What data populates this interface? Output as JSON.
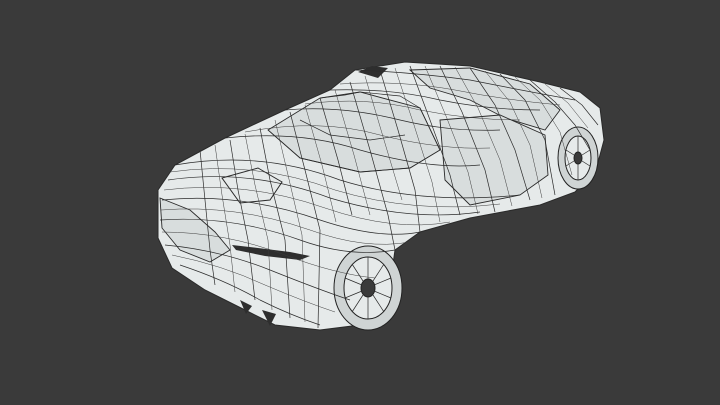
{
  "viewport": {
    "background_color": "#3a3a3a",
    "subject": "wireframe-sports-car-model",
    "wire_color": "#2a2a2a",
    "surface_color": "#e6eaea"
  }
}
